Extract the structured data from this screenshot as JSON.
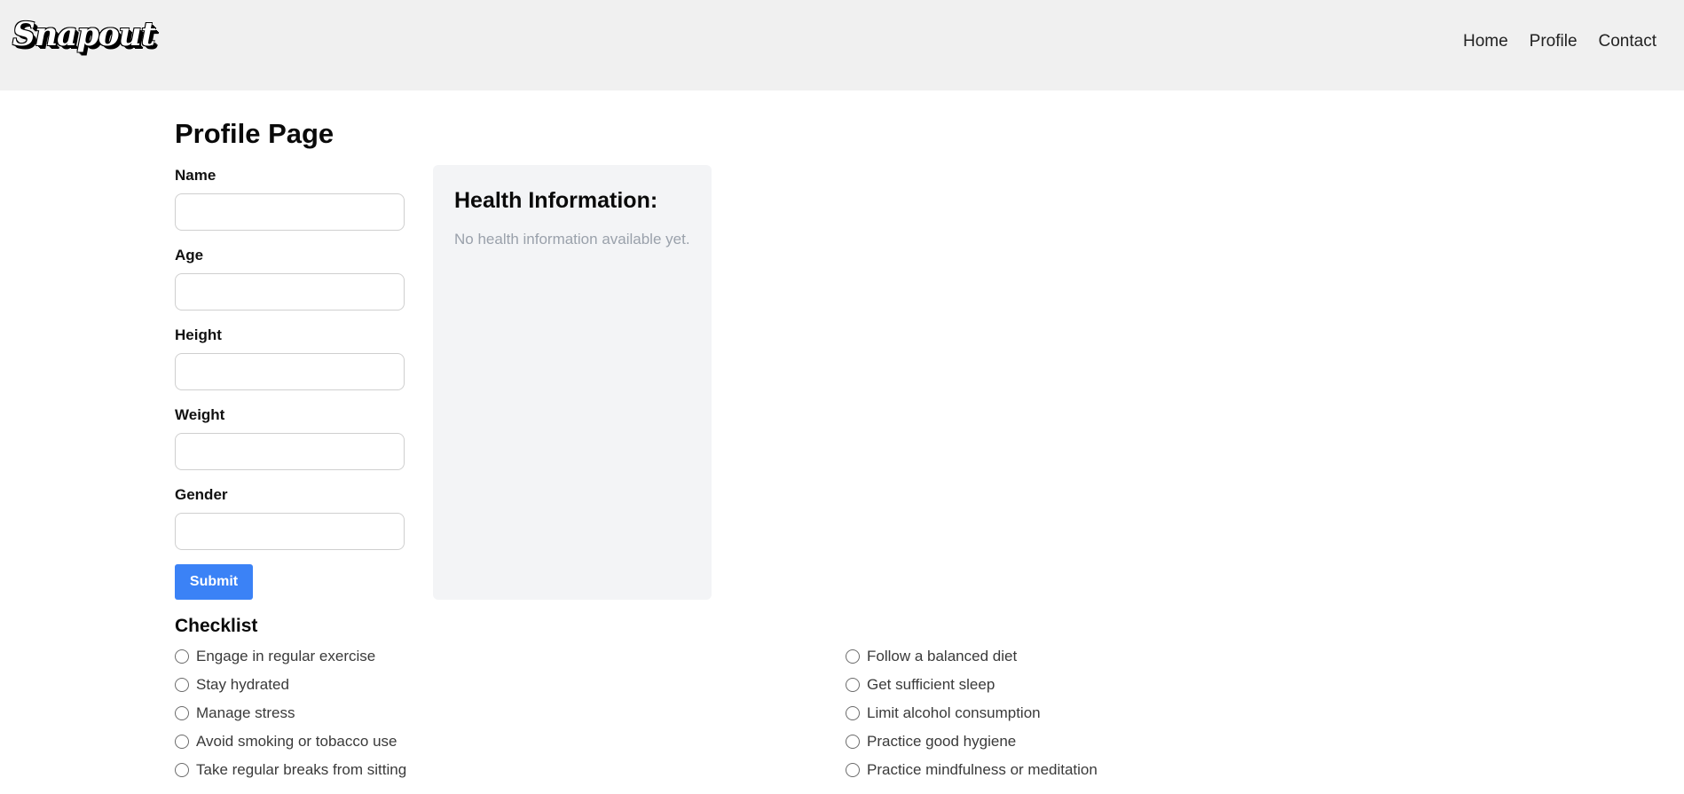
{
  "navbar": {
    "logo_text": "Snapout",
    "links": [
      "Home",
      "Profile",
      "Contact"
    ]
  },
  "page": {
    "title": "Profile Page"
  },
  "form": {
    "fields": [
      {
        "label": "Name",
        "value": ""
      },
      {
        "label": "Age",
        "value": ""
      },
      {
        "label": "Height",
        "value": ""
      },
      {
        "label": "Weight",
        "value": ""
      },
      {
        "label": "Gender",
        "value": ""
      }
    ],
    "submit_label": "Submit"
  },
  "health": {
    "title": "Health Information:",
    "empty_text": "No health information available yet."
  },
  "checklist": {
    "title": "Checklist",
    "left": [
      "Engage in regular exercise",
      "Stay hydrated",
      "Manage stress",
      "Avoid smoking or tobacco use",
      "Take regular breaks from sitting"
    ],
    "right": [
      "Follow a balanced diet",
      "Get sufficient sleep",
      "Limit alcohol consumption",
      "Practice good hygiene",
      "Practice mindfulness or meditation"
    ]
  },
  "colors": {
    "navbar_bg": "#f0f0f0",
    "accent": "#3b82f6",
    "panel_bg": "#f3f4f6",
    "muted_text": "#9aa1ab"
  }
}
